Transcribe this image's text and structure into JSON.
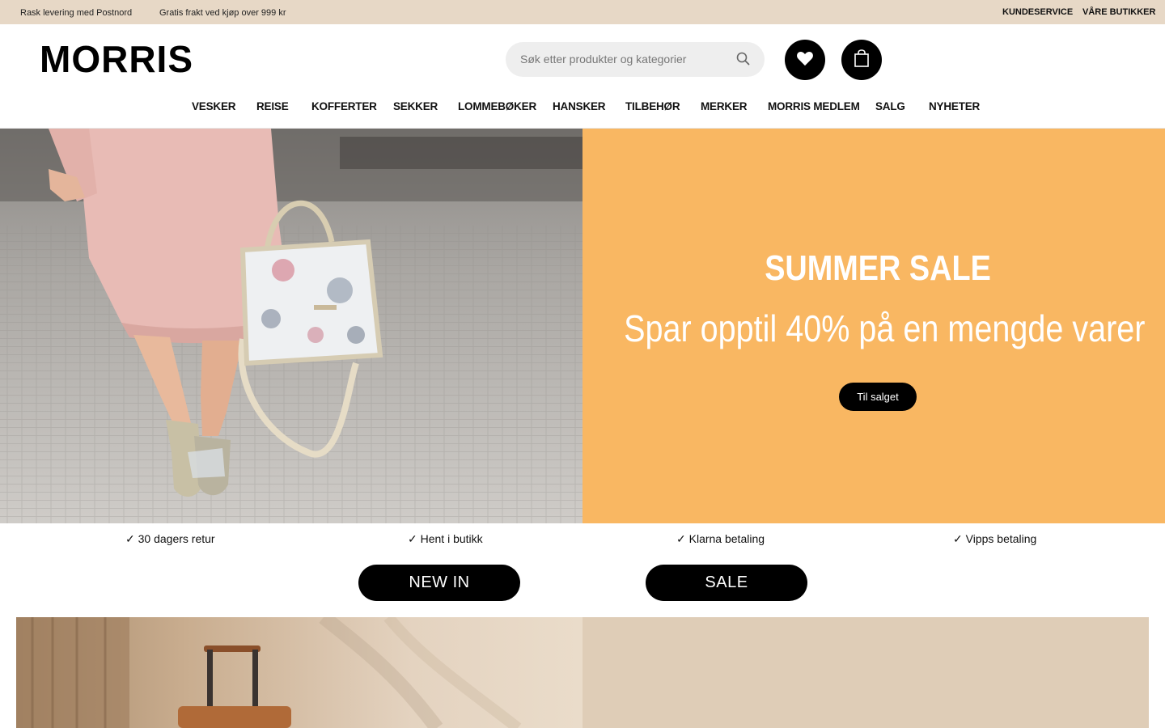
{
  "topbar": {
    "messages": [
      "Rask levering med Postnord",
      "Gratis frakt ved kjøp over 999 kr"
    ],
    "links": [
      "KUNDESERVICE",
      "VÅRE BUTIKKER"
    ]
  },
  "header": {
    "logo": "MORRIS",
    "search_placeholder": "Søk etter produkter og kategorier",
    "icons": [
      "search-icon",
      "heart-icon",
      "shopping-bag-icon"
    ]
  },
  "nav": {
    "items": [
      "VESKER",
      "REISE",
      "KOFFERTER",
      "SEKKER",
      "LOMMEBØKER",
      "HANSKER",
      "TILBEHØR",
      "MERKER",
      "MORRIS MEDLEM",
      "SALG",
      "NYHETER"
    ]
  },
  "hero": {
    "title": "SUMMER SALE",
    "subtitle": "Spar opptil 40% på en mengde varer",
    "button": "Til salget",
    "background_color": "#f9b762"
  },
  "usps": [
    "✓ 30 dagers retur",
    "✓ Hent i butikk",
    "✓ Klarna betaling",
    "✓ Vipps betaling"
  ],
  "buttons": {
    "new_in": "NEW IN",
    "sale": "SALE"
  },
  "colors": {
    "topbar": "#e7d8c6",
    "banner2": "#dfcdb7",
    "accent": "#000000"
  }
}
